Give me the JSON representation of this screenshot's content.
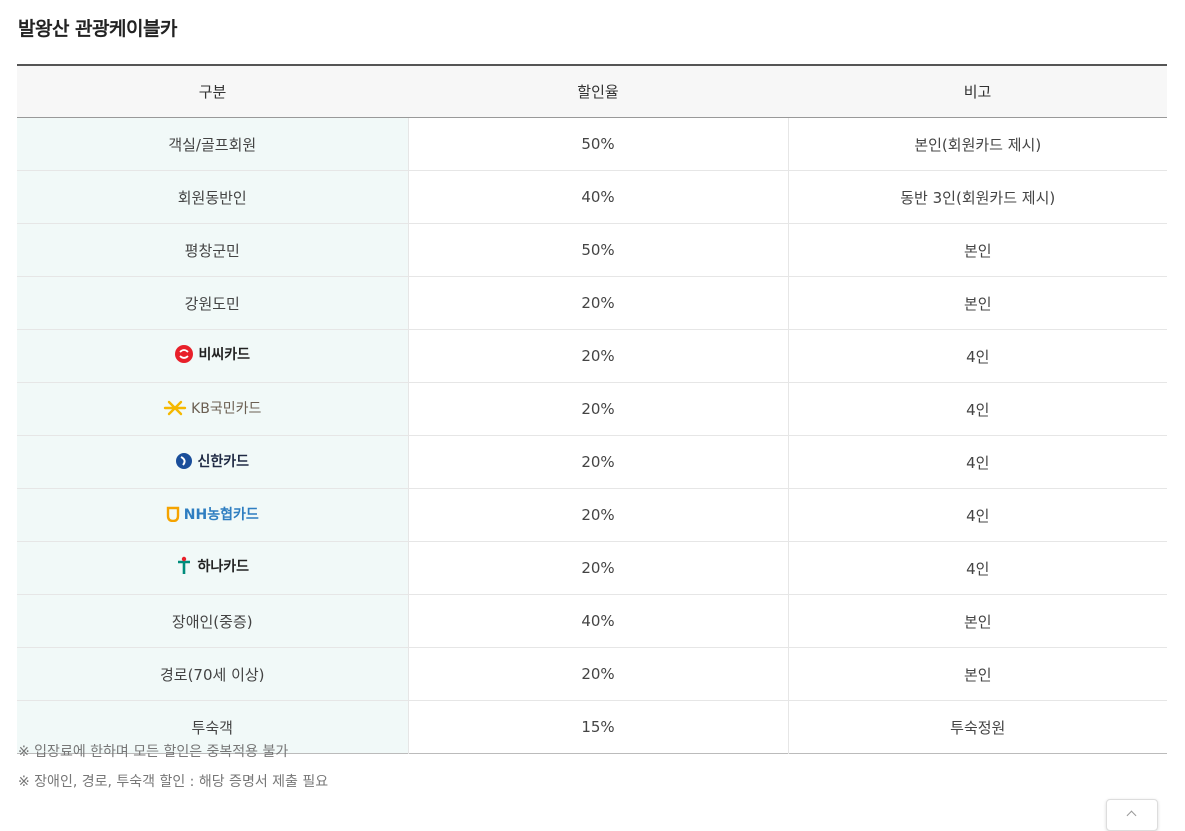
{
  "title": "발왕산 관광케이블카",
  "table": {
    "headers": [
      "구분",
      "할인율",
      "비고"
    ],
    "rows": [
      {
        "category": "객실/골프회원",
        "rate": "50%",
        "note": "본인(회원카드 제시)"
      },
      {
        "category": "회원동반인",
        "rate": "40%",
        "note": "동반 3인(회원카드 제시)"
      },
      {
        "category": "평창군민",
        "rate": "50%",
        "note": "본인"
      },
      {
        "category": "강원도민",
        "rate": "20%",
        "note": "본인"
      },
      {
        "category": "비씨카드",
        "logo": "bc-card-logo",
        "logo_color": "#e8202a",
        "rate": "20%",
        "note": "4인"
      },
      {
        "category": "KB국민카드",
        "logo": "kb-card-logo",
        "logo_color": "#f5b800",
        "rate": "20%",
        "note": "4인"
      },
      {
        "category": "신한카드",
        "logo": "shinhan-card-logo",
        "logo_color": "#1a4e9a",
        "rate": "20%",
        "note": "4인"
      },
      {
        "category": "NH농협카드",
        "logo": "nh-card-logo",
        "logo_color": "#2f7ec1",
        "rate": "20%",
        "note": "4인"
      },
      {
        "category": "하나카드",
        "logo": "hana-card-logo",
        "logo_color": "#008c7c",
        "rate": "20%",
        "note": "4인"
      },
      {
        "category": "장애인(중증)",
        "rate": "40%",
        "note": "본인"
      },
      {
        "category": "경로(70세 이상)",
        "rate": "20%",
        "note": "본인"
      },
      {
        "category": "투숙객",
        "rate": "15%",
        "note": "투숙정원"
      }
    ]
  },
  "notes": [
    "※ 입장료에 한하며 모든 할인은 중복적용 불가",
    "※ 장애인, 경로, 투숙객 할인 : 해당 증명서 제출 필요"
  ],
  "colors": {
    "category_bg": "#f1f9f8",
    "header_bg": "#f7f7f7"
  }
}
